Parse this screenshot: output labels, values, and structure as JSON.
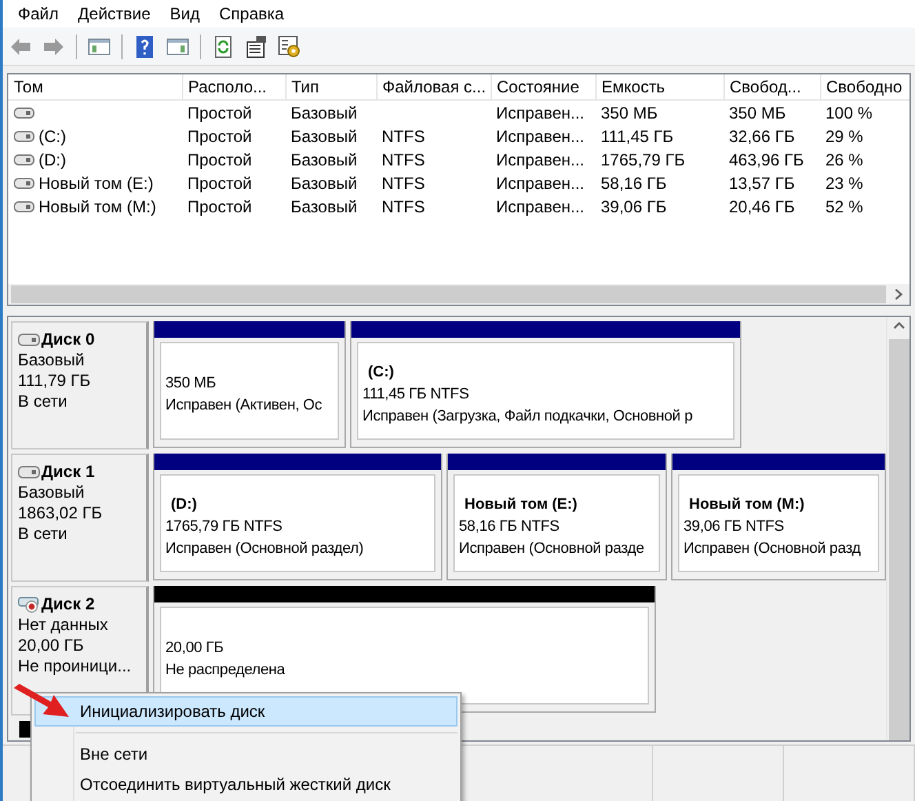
{
  "menu_bar": [
    "Файл",
    "Действие",
    "Вид",
    "Справка"
  ],
  "volume_table": {
    "columns": [
      "Том",
      "Располо...",
      "Тип",
      "Файловая с...",
      "Состояние",
      "Емкость",
      "Свобод...",
      "Свободно"
    ],
    "rows": [
      [
        "",
        "Простой",
        "Базовый",
        "",
        "Исправен...",
        "350 МБ",
        "350 МБ",
        "100 %"
      ],
      [
        "(C:)",
        "Простой",
        "Базовый",
        "NTFS",
        "Исправен...",
        "111,45 ГБ",
        "32,66 ГБ",
        "29 %"
      ],
      [
        "(D:)",
        "Простой",
        "Базовый",
        "NTFS",
        "Исправен...",
        "1765,79 ГБ",
        "463,96 ГБ",
        "26 %"
      ],
      [
        "Новый том (E:)",
        "Простой",
        "Базовый",
        "NTFS",
        "Исправен...",
        "58,16 ГБ",
        "13,57 ГБ",
        "23 %"
      ],
      [
        "Новый том (M:)",
        "Простой",
        "Базовый",
        "NTFS",
        "Исправен...",
        "39,06 ГБ",
        "20,46 ГБ",
        "52 %"
      ]
    ]
  },
  "disks": [
    {
      "kind": "online",
      "name": "Диск 0",
      "type": "Базовый",
      "size": "111,79 ГБ",
      "status": "В сети",
      "partitions": [
        {
          "kind": "primary",
          "size": "350 МБ",
          "status": "Исправен (Активен, Ос"
        },
        {
          "kind": "primary",
          "title": "(C:)",
          "size": "111,45 ГБ NTFS",
          "status": "Исправен (Загрузка, Файл подкачки, Основной р"
        }
      ]
    },
    {
      "kind": "online",
      "name": "Диск 1",
      "type": "Базовый",
      "size": "1863,02 ГБ",
      "status": "В сети",
      "partitions": [
        {
          "kind": "primary",
          "title": "(D:)",
          "size": "1765,79 ГБ NTFS",
          "status": "Исправен (Основной раздел)"
        },
        {
          "kind": "primary",
          "title": "Новый том  (E:)",
          "size": "58,16 ГБ NTFS",
          "status": "Исправен (Основной разде"
        },
        {
          "kind": "primary",
          "title": "Новый том  (M:)",
          "size": "39,06 ГБ NTFS",
          "status": "Исправен (Основной разд"
        }
      ]
    },
    {
      "kind": "uninitialized",
      "name": "Диск 2",
      "type": "Нет данных",
      "size": "20,00 ГБ",
      "status": "Не проиници...",
      "partitions": [
        {
          "kind": "unallocated",
          "size": "20,00 ГБ",
          "status": "Не распределена"
        }
      ]
    }
  ],
  "legend": [
    {
      "kind": "unallocated"
    }
  ],
  "context_menu": {
    "groups": [
      [
        {
          "label": "Инициализировать диск",
          "selected": true
        }
      ],
      [
        {
          "label": "Вне сети",
          "selected": false
        },
        {
          "label": "Отсоединить виртуальный жесткий диск",
          "selected": false
        }
      ]
    ]
  }
}
